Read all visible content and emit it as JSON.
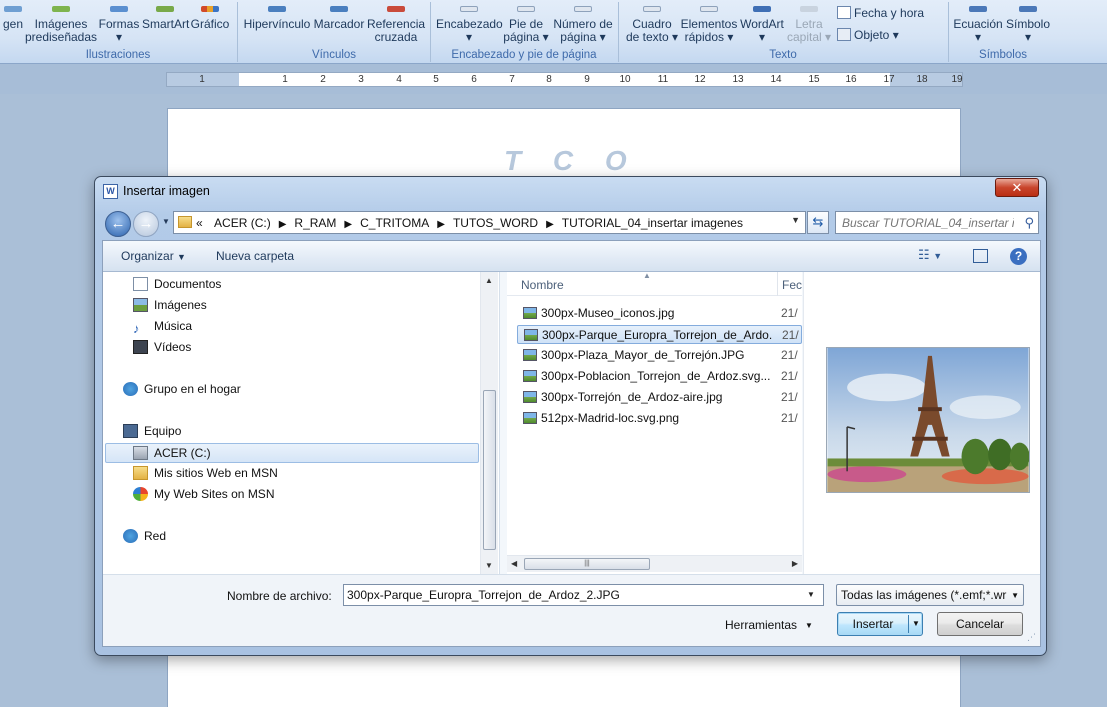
{
  "ribbon": {
    "buttons": [
      {
        "label1": "gen",
        "label2": "",
        "disabled": false
      },
      {
        "label1": "Imágenes",
        "label2": "prediseñadas",
        "disabled": false
      },
      {
        "label1": "Formas",
        "label2": "",
        "disabled": false
      },
      {
        "label1": "SmartArt",
        "label2": "",
        "disabled": false
      },
      {
        "label1": "Gráfico",
        "label2": "",
        "disabled": false
      },
      {
        "label1": "Hipervínculo",
        "label2": "",
        "disabled": false
      },
      {
        "label1": "Marcador",
        "label2": "",
        "disabled": false
      },
      {
        "label1": "Referencia",
        "label2": "cruzada",
        "disabled": false
      },
      {
        "label1": "Encabezado",
        "label2": "",
        "disabled": false
      },
      {
        "label1": "Pie de",
        "label2": "página",
        "disabled": false
      },
      {
        "label1": "Número de",
        "label2": "página",
        "disabled": false
      },
      {
        "label1": "Cuadro",
        "label2": "de texto",
        "disabled": false
      },
      {
        "label1": "Elementos",
        "label2": "rápidos",
        "disabled": false
      },
      {
        "label1": "WordArt",
        "label2": "",
        "disabled": false
      },
      {
        "label1": "Letra",
        "label2": "capital",
        "disabled": true
      },
      {
        "label1": "Ecuación",
        "label2": "",
        "disabled": false
      },
      {
        "label1": "Símbolo",
        "label2": "",
        "disabled": false
      }
    ],
    "fecha_hora": "Fecha y hora",
    "objeto": "Objeto",
    "groups": {
      "ilustraciones": "Ilustraciones",
      "vinculos": "Vínculos",
      "encabezado": "Encabezado y pie de página",
      "texto": "Texto",
      "simbolos": "Símbolos"
    }
  },
  "ruler": {
    "numbers": [
      "1",
      "1",
      "2",
      "3",
      "4",
      "5",
      "6",
      "7",
      "8",
      "9",
      "10",
      "11",
      "12",
      "13",
      "14",
      "15",
      "16",
      "17",
      "18",
      "19"
    ]
  },
  "page": {
    "logo": "T C O"
  },
  "dialog": {
    "title": "Insertar imagen",
    "app_icon": "W",
    "close": "✕",
    "breadcrumb": [
      "«",
      "ACER (C:)",
      "R_RAM",
      "C_TRITOMA",
      "TUTOS_WORD",
      "TUTORIAL_04_insertar imagenes"
    ],
    "search_placeholder": "Buscar TUTORIAL_04_insertar i...",
    "toolbar": {
      "organize": "Organizar",
      "new_folder": "Nueva carpeta"
    },
    "nav": {
      "documentos": "Documentos",
      "imagenes": "Imágenes",
      "musica": "Música",
      "videos": "Vídeos",
      "grupo_hogar": "Grupo en el hogar",
      "equipo": "Equipo",
      "acer": "ACER (C:)",
      "msn_es": "Mis sitios Web en MSN",
      "msn_en": "My Web Sites on MSN",
      "red": "Red"
    },
    "columns": {
      "name": "Nombre",
      "date": "Fec"
    },
    "files": [
      {
        "name": "300px-Museo_iconos.jpg",
        "date": "21/"
      },
      {
        "name": "300px-Parque_Europra_Torrejon_de_Ardo...",
        "date": "21/"
      },
      {
        "name": "300px-Plaza_Mayor_de_Torrejón.JPG",
        "date": "21/"
      },
      {
        "name": "300px-Poblacion_Torrejon_de_Ardoz.svg....",
        "date": "21/"
      },
      {
        "name": "300px-Torrejón_de_Ardoz-aire.jpg",
        "date": "21/"
      },
      {
        "name": "512px-Madrid-loc.svg.png",
        "date": "21/"
      }
    ],
    "selected_file_index": 1,
    "filename_label": "Nombre de archivo:",
    "filename_value": "300px-Parque_Europra_Torrejon_de_Ardoz_2.JPG",
    "file_type": "Todas las imágenes (*.emf;*.wr",
    "tools": "Herramientas",
    "insert": "Insertar",
    "cancel": "Cancelar"
  },
  "colors": {
    "accent": "#3c7fb1",
    "ribbon_text": "#1e395b",
    "group_label": "#3e6aaa",
    "selection": "#cfe2f7"
  }
}
